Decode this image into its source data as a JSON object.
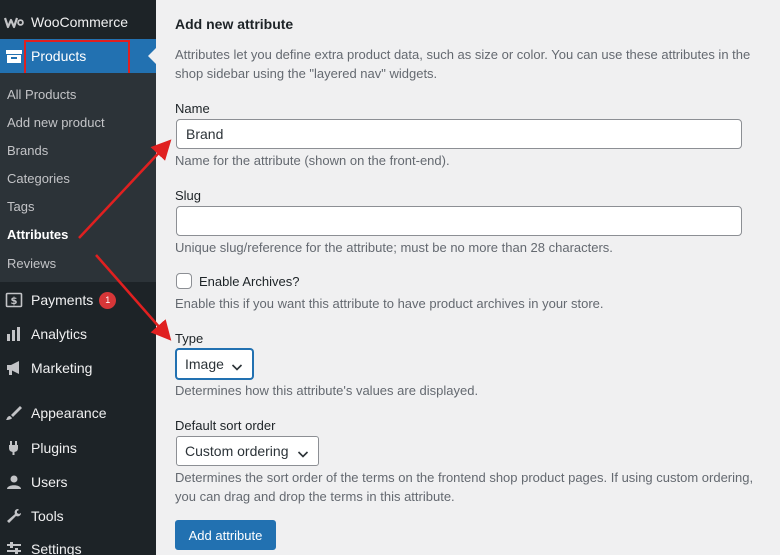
{
  "sidebar": {
    "woocommerce": "WooCommerce",
    "products": "Products",
    "submenu": [
      "All Products",
      "Add new product",
      "Brands",
      "Categories",
      "Tags",
      "Attributes",
      "Reviews"
    ],
    "payments": "Payments",
    "payments_badge": "1",
    "analytics": "Analytics",
    "marketing": "Marketing",
    "appearance": "Appearance",
    "plugins": "Plugins",
    "users": "Users",
    "tools": "Tools",
    "settings": "Settings"
  },
  "form": {
    "heading": "Add new attribute",
    "intro": "Attributes let you define extra product data, such as size or color. You can use these attributes in the shop sidebar using the \"layered nav\" widgets.",
    "name_label": "Name",
    "name_value": "Brand",
    "name_desc": "Name for the attribute (shown on the front-end).",
    "slug_label": "Slug",
    "slug_value": "",
    "slug_desc": "Unique slug/reference for the attribute; must be no more than 28 characters.",
    "archives_label": "Enable Archives?",
    "archives_desc": "Enable this if you want this attribute to have product archives in your store.",
    "type_label": "Type",
    "type_value": "Image",
    "type_desc": "Determines how this attribute's values are displayed.",
    "sort_label": "Default sort order",
    "sort_value": "Custom ordering",
    "sort_desc": "Determines the sort order of the terms on the frontend shop product pages. If using custom ordering, you can drag and drop the terms in this attribute.",
    "submit_label": "Add attribute"
  },
  "colors": {
    "sidebar_bg": "#1d2327",
    "submenu_bg": "#2c3338",
    "accent": "#2271b1",
    "annotation": "#e02020",
    "badge": "#d63638"
  }
}
